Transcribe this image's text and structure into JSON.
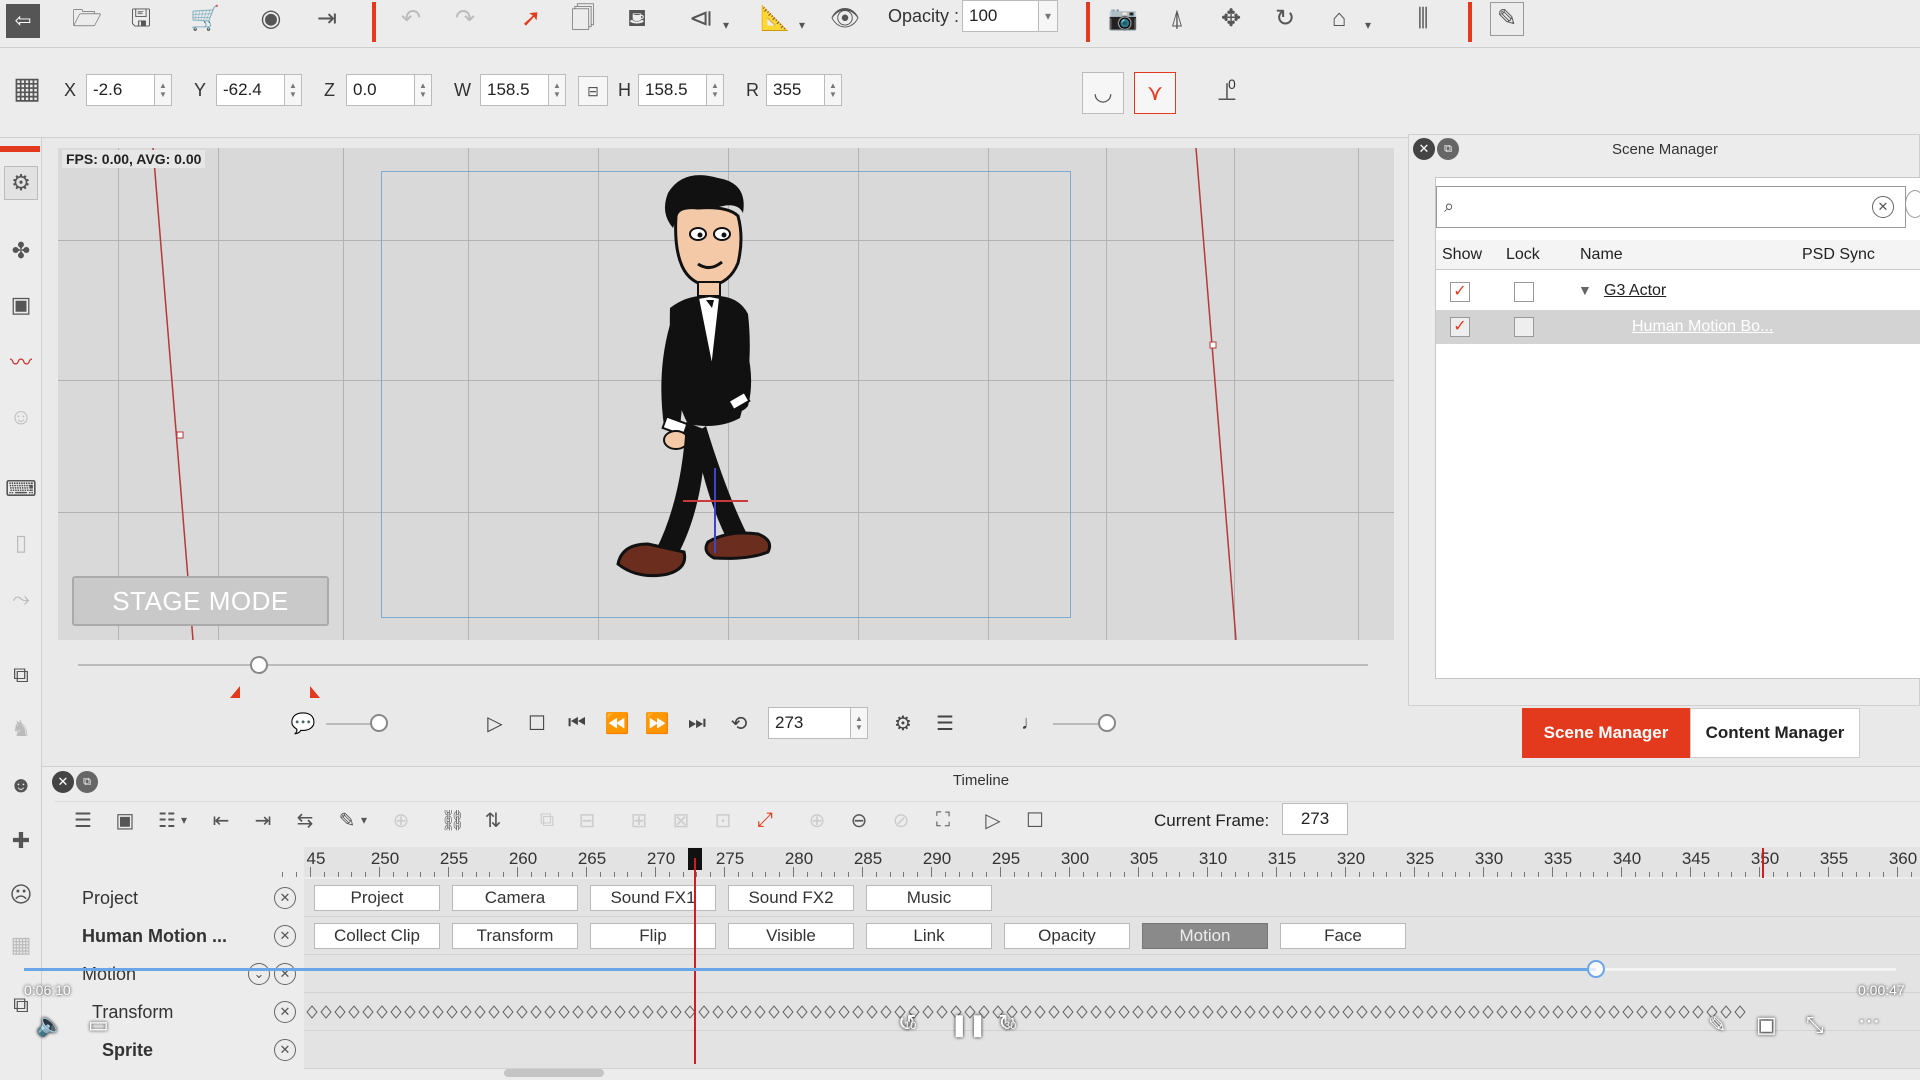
{
  "toolbar": {
    "opacity_label": "Opacity :",
    "opacity_value": "100"
  },
  "transform": {
    "x_label": "X",
    "x_value": "-2.6",
    "y_label": "Y",
    "y_value": "-62.4",
    "z_label": "Z",
    "z_value": "0.0",
    "w_label": "W",
    "w_value": "158.5",
    "h_label": "H",
    "h_value": "158.5",
    "r_label": "R",
    "r_value": "355",
    "ik_label": "0"
  },
  "stage": {
    "fps_text": "FPS: 0.00, AVG: 0.00",
    "mode_label": "STAGE MODE"
  },
  "playback": {
    "frame_value": "273"
  },
  "scene_manager": {
    "title": "Scene Manager",
    "search_placeholder": "",
    "columns": [
      "Show",
      "Lock",
      "Name",
      "PSD Sync"
    ],
    "rows": [
      {
        "name": "G3 Actor",
        "show": true,
        "lock": false
      },
      {
        "name": "Human Motion Bo...",
        "show": true,
        "lock": false
      }
    ],
    "tab_scene": "Scene Manager",
    "tab_content": "Content Manager"
  },
  "timeline": {
    "title": "Timeline",
    "current_frame_label": "Current Frame:",
    "current_frame_value": "273",
    "ruler_ticks": [
      "45",
      "250",
      "255",
      "260",
      "265",
      "270",
      "275",
      "280",
      "285",
      "290",
      "295",
      "300",
      "305",
      "310",
      "315",
      "320",
      "325",
      "330",
      "335",
      "340",
      "345",
      "350",
      "355",
      "360"
    ],
    "tracks": [
      {
        "label": "Project",
        "bold": false
      },
      {
        "label": "Human Motion ...",
        "bold": true
      },
      {
        "label": "Motion",
        "bold": false
      },
      {
        "label": "Transform",
        "bold": false
      },
      {
        "label": "Sprite",
        "bold": true
      }
    ],
    "project_channels": [
      "Project",
      "Camera",
      "Sound FX1",
      "Sound FX2",
      "Music"
    ],
    "actor_channels": [
      "Collect Clip",
      "Transform",
      "Flip",
      "Visible",
      "Link",
      "Opacity",
      "Motion",
      "Face"
    ]
  },
  "video": {
    "elapsed": "0:06:10",
    "remaining": "0:00:47",
    "skip_back": "10",
    "skip_forward": "30",
    "progress": 0.84
  },
  "colors": {
    "accent": "#e3391c",
    "frame_blue": "#7fa8d0",
    "playhead": "#cc1f1f"
  }
}
